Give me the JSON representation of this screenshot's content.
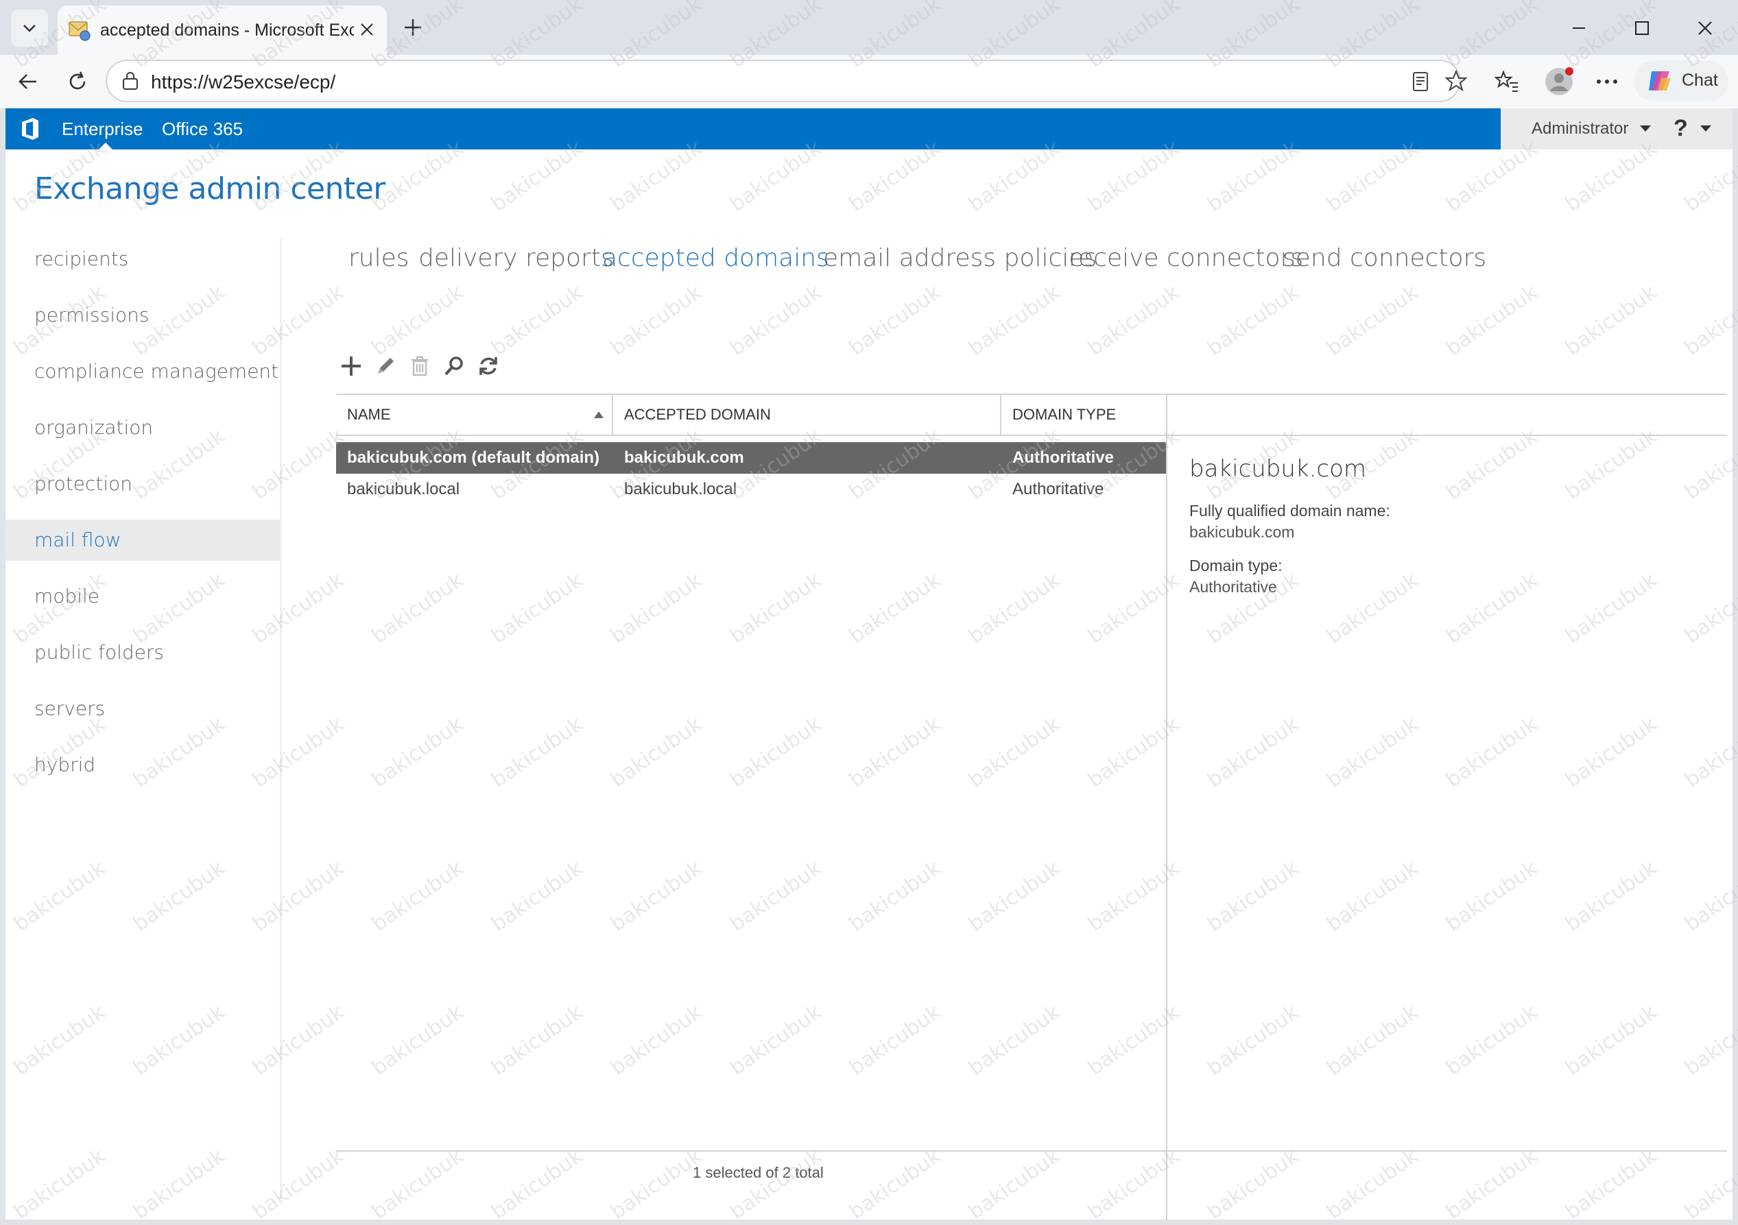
{
  "browser": {
    "tab_title": "accepted domains - Microsoft Exchange",
    "url": "https://w25excse/ecp/",
    "chat_label": "Chat"
  },
  "suitebar": {
    "links": [
      "Enterprise",
      "Office 365"
    ],
    "user": "Administrator",
    "help": "?"
  },
  "app_title": "Exchange admin center",
  "nav": {
    "items": [
      "recipients",
      "permissions",
      "compliance management",
      "organization",
      "protection",
      "mail flow",
      "mobile",
      "public folders",
      "servers",
      "hybrid"
    ],
    "active": "mail flow"
  },
  "subtabs": {
    "items": [
      "rules",
      "delivery reports",
      "accepted domains",
      "email address policies",
      "receive connectors",
      "send connectors"
    ],
    "active": "accepted domains"
  },
  "actions": [
    "add-icon",
    "edit-icon",
    "delete-icon",
    "search-icon",
    "refresh-icon"
  ],
  "grid": {
    "columns": [
      "NAME",
      "ACCEPTED DOMAIN",
      "DOMAIN TYPE"
    ],
    "sort_column": "NAME",
    "sort_direction": "ascending",
    "rows": [
      {
        "name": "bakicubuk.com (default domain)",
        "domain": "bakicubuk.com",
        "type": "Authoritative",
        "selected": true
      },
      {
        "name": "bakicubuk.local",
        "domain": "bakicubuk.local",
        "type": "Authoritative",
        "selected": false
      }
    ]
  },
  "detail": {
    "title": "bakicubuk.com",
    "fqdn_label": "Fully qualified domain name:",
    "fqdn_value": "bakicubuk.com",
    "type_label": "Domain type:",
    "type_value": "Authoritative"
  },
  "status": "1 selected of 2 total",
  "watermark": "bakicubuk",
  "colors": {
    "suitebar": "#0072c6",
    "accent": "#1e73be",
    "selected_row": "#666666"
  }
}
